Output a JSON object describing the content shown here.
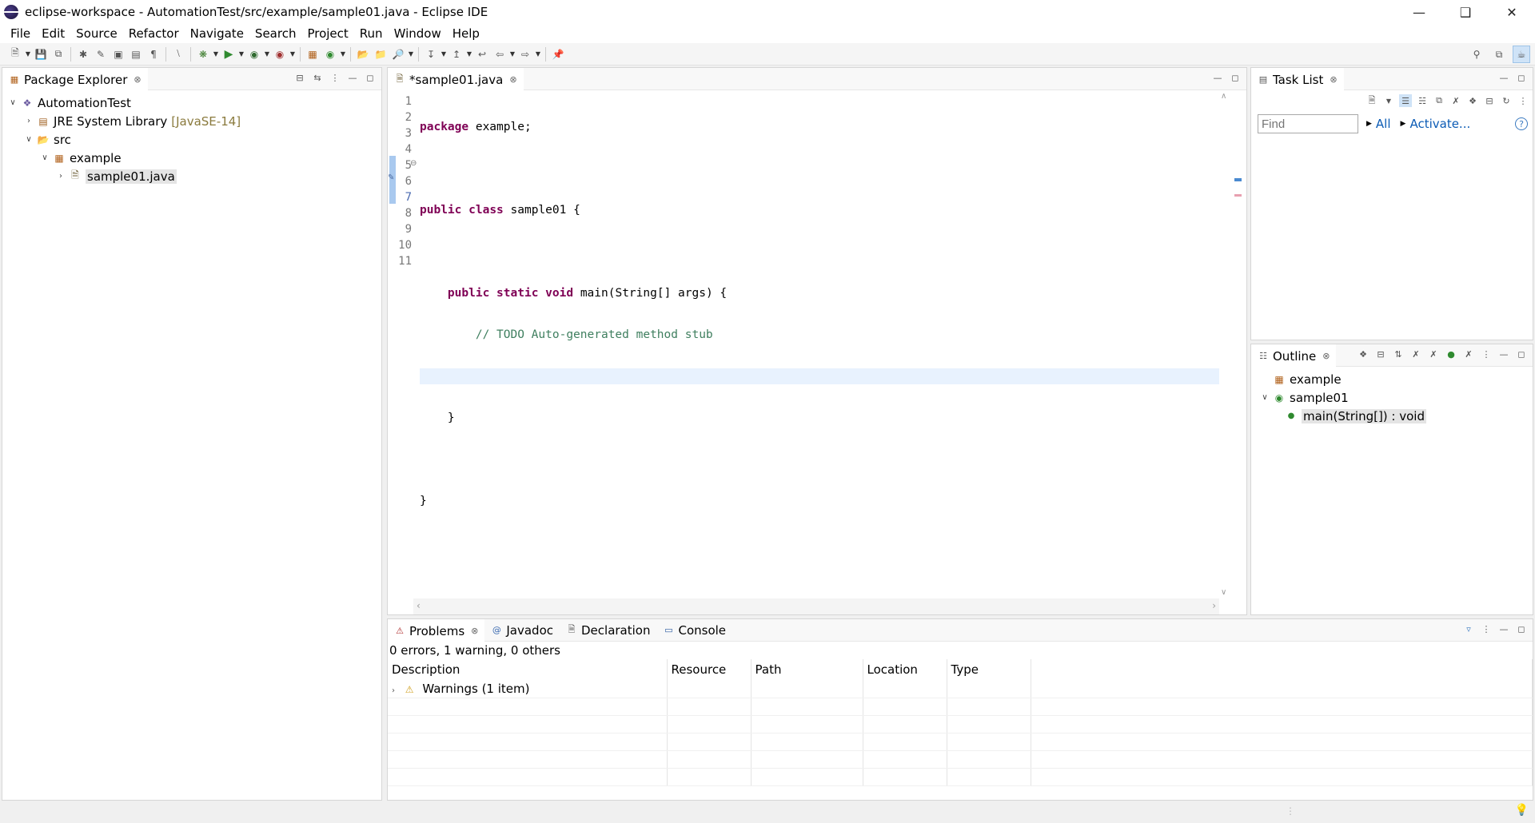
{
  "window": {
    "title": "eclipse-workspace - AutomationTest/src/example/sample01.java - Eclipse IDE"
  },
  "menu": [
    "File",
    "Edit",
    "Source",
    "Refactor",
    "Navigate",
    "Search",
    "Project",
    "Run",
    "Window",
    "Help"
  ],
  "package_explorer": {
    "tab_label": "Package Explorer",
    "tree": {
      "project": "AutomationTest",
      "jre": "JRE System Library",
      "jre_version": "[JavaSE-14]",
      "src": "src",
      "package": "example",
      "file": "sample01.java"
    }
  },
  "editor": {
    "tab_label": "*sample01.java",
    "line_numbers": [
      "1",
      "2",
      "3",
      "4",
      "5",
      "6",
      "7",
      "8",
      "9",
      "10",
      "11"
    ],
    "code": {
      "l1_kw": "package",
      "l1_rest": " example;",
      "l3_kw1": "public",
      "l3_kw2": "class",
      "l3_rest": " sample01 {",
      "l5_indent": "    ",
      "l5_kw1": "public",
      "l5_kw2": "static",
      "l5_kw3": "void",
      "l5_rest": " main(String[] args) {",
      "l6_comment": "        // TODO Auto-generated method stub",
      "l8": "    }",
      "l10": "}"
    }
  },
  "task_list": {
    "tab_label": "Task List",
    "find_placeholder": "Find",
    "all_label": "All",
    "activate_label": "Activate..."
  },
  "outline": {
    "tab_label": "Outline",
    "package": "example",
    "class": "sample01",
    "method": "main(String[]) : void"
  },
  "bottom": {
    "tabs": [
      "Problems",
      "Javadoc",
      "Declaration",
      "Console"
    ],
    "summary": "0 errors, 1 warning, 0 others",
    "columns": [
      "Description",
      "Resource",
      "Path",
      "Location",
      "Type"
    ],
    "rows": [
      {
        "description": "Warnings (1 item)"
      }
    ]
  },
  "colors": {
    "keyword": "#7f0055",
    "comment": "#3f7f5f",
    "current_line": "#e8f2fe",
    "link": "#0b5bb5"
  }
}
